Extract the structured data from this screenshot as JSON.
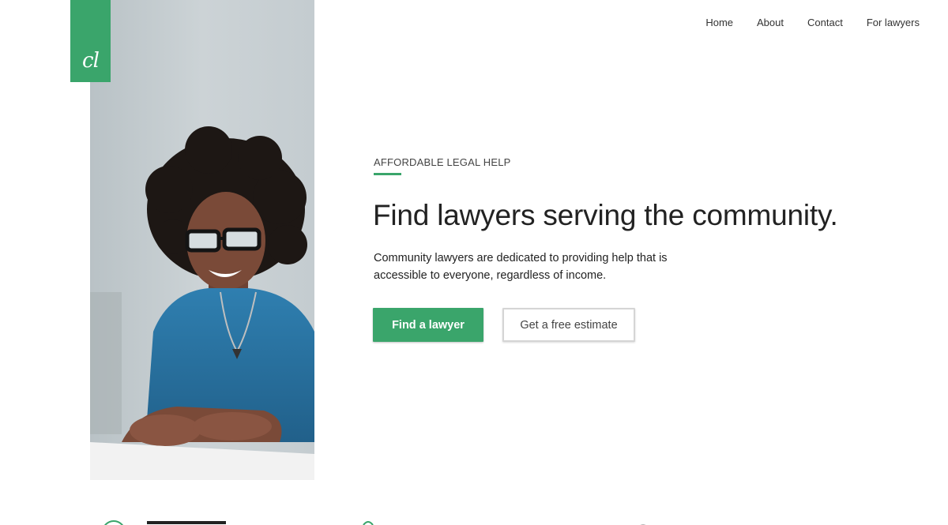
{
  "brand": {
    "logo_text": "cl",
    "accent_color": "#3aa56b"
  },
  "nav": {
    "items": [
      {
        "label": "Home"
      },
      {
        "label": "About"
      },
      {
        "label": "Contact"
      },
      {
        "label": "For lawyers"
      }
    ]
  },
  "hero": {
    "eyebrow": "AFFORDABLE LEGAL HELP",
    "headline": "Find lawyers serving the community.",
    "description": "Community lawyers are dedicated to providing help that is accessible to everyone, regardless of income.",
    "primary_button": "Find a lawyer",
    "secondary_button": "Get a free estimate",
    "photo_alt": "woman-smiling-photo"
  },
  "features": {
    "icons": [
      "clock-icon",
      "apple-icon",
      "chat-icon"
    ]
  }
}
